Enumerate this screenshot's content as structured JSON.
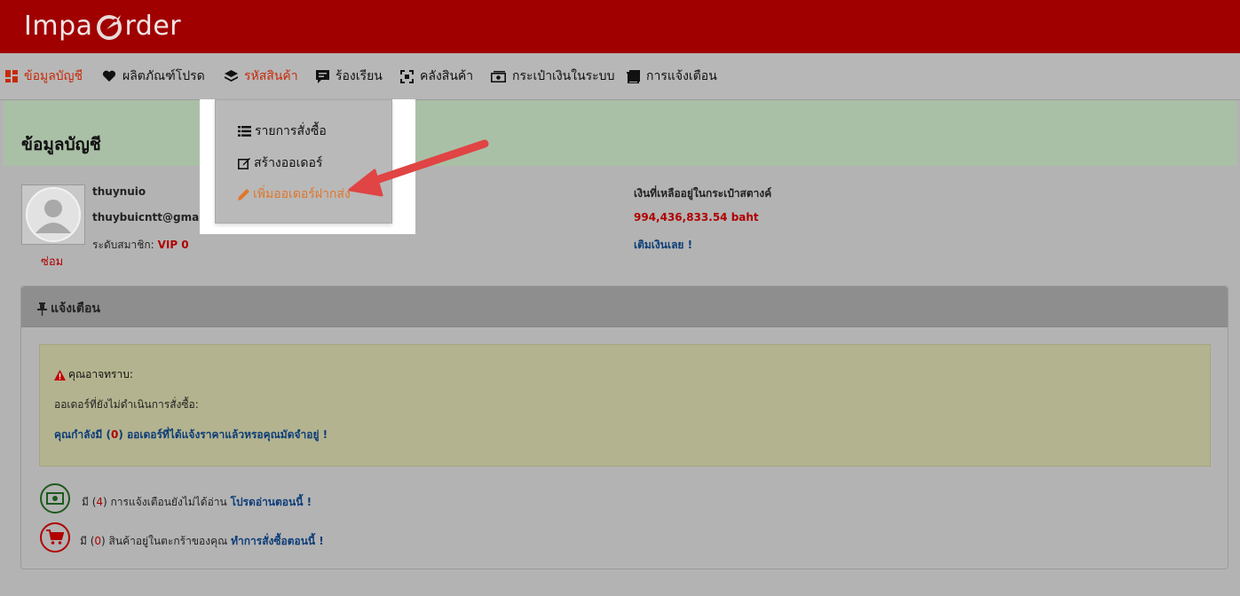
{
  "brand": {
    "logo_left": "Impa",
    "logo_right": "rder"
  },
  "nav": {
    "items": [
      {
        "label": "ข้อมูลบัญชี",
        "icon": "dashboard-icon"
      },
      {
        "label": "ผลิตภัณฑ์โปรด",
        "icon": "heart-icon"
      },
      {
        "label": "รหัสสินค้า",
        "icon": "layers-icon"
      },
      {
        "label": "ร้องเรียน",
        "icon": "comment-icon"
      },
      {
        "label": "คลังสินค้า",
        "icon": "warehouse-icon"
      },
      {
        "label": "กระเป๋าเงินในระบบ",
        "icon": "money-icon"
      },
      {
        "label": "การแจ้งเตือน",
        "icon": "bookmarks-icon"
      }
    ],
    "active_index": 0,
    "open_menu_index": 2
  },
  "dropdown": {
    "items": [
      {
        "label": "รายการสั่งซื้อ",
        "icon": "list-icon"
      },
      {
        "label": "สร้างออเดอร์",
        "icon": "edit-icon"
      },
      {
        "label": "เพิ่มออเดอร์ฝากส่ง",
        "icon": "pencil-icon"
      }
    ],
    "highlighted_index": 2
  },
  "page": {
    "title": "ข้อมูลบัญชี"
  },
  "account": {
    "username": "thuynuio",
    "email": "thuybuicntt@gmail.com",
    "level_label": "ระดับสมาชิก:",
    "level_value": "VIP 0",
    "avatar_link": "ซ่อม"
  },
  "wallet": {
    "label": "เงินที่เหลืออยู่ในกระเป๋าสตางค์",
    "amount": "994,436,833.54 baht",
    "topup_link": "เติมเงินเลย !"
  },
  "notice": {
    "title": "แจ้งเตือน",
    "alert_heading": "คุณอาจทราบ:",
    "alert_line2": "ออเดอร์ที่ยังไม่ดำเนินการสั่งซื้อ:",
    "alert_line3_pre": "คุณกำลังมี (",
    "alert_line3_count": "0",
    "alert_line3_post": ") ออเดอร์ที่ได้แจ้งราคาแล้วหรอคุณมัดจำอยู่ !",
    "row1_pre": "มี (",
    "row1_count": "4",
    "row1_mid": ") การแจ้งเตือนยังไม่ได้อ่าน",
    "row1_link": "โปรดอ่านตอนนี้ !",
    "row2_pre": "มี (",
    "row2_count": "0",
    "row2_mid": ") สินค้าอยู่ในตะกร้าของคุณ",
    "row2_link": "ทำการสั่งซื้อตอนนี้ !"
  },
  "colors": {
    "header": "#a00000",
    "accent_red": "#b00000",
    "link_blue": "#0d3d78",
    "highlight_orange": "#e0762a",
    "annotation_arrow": "#e04444"
  }
}
